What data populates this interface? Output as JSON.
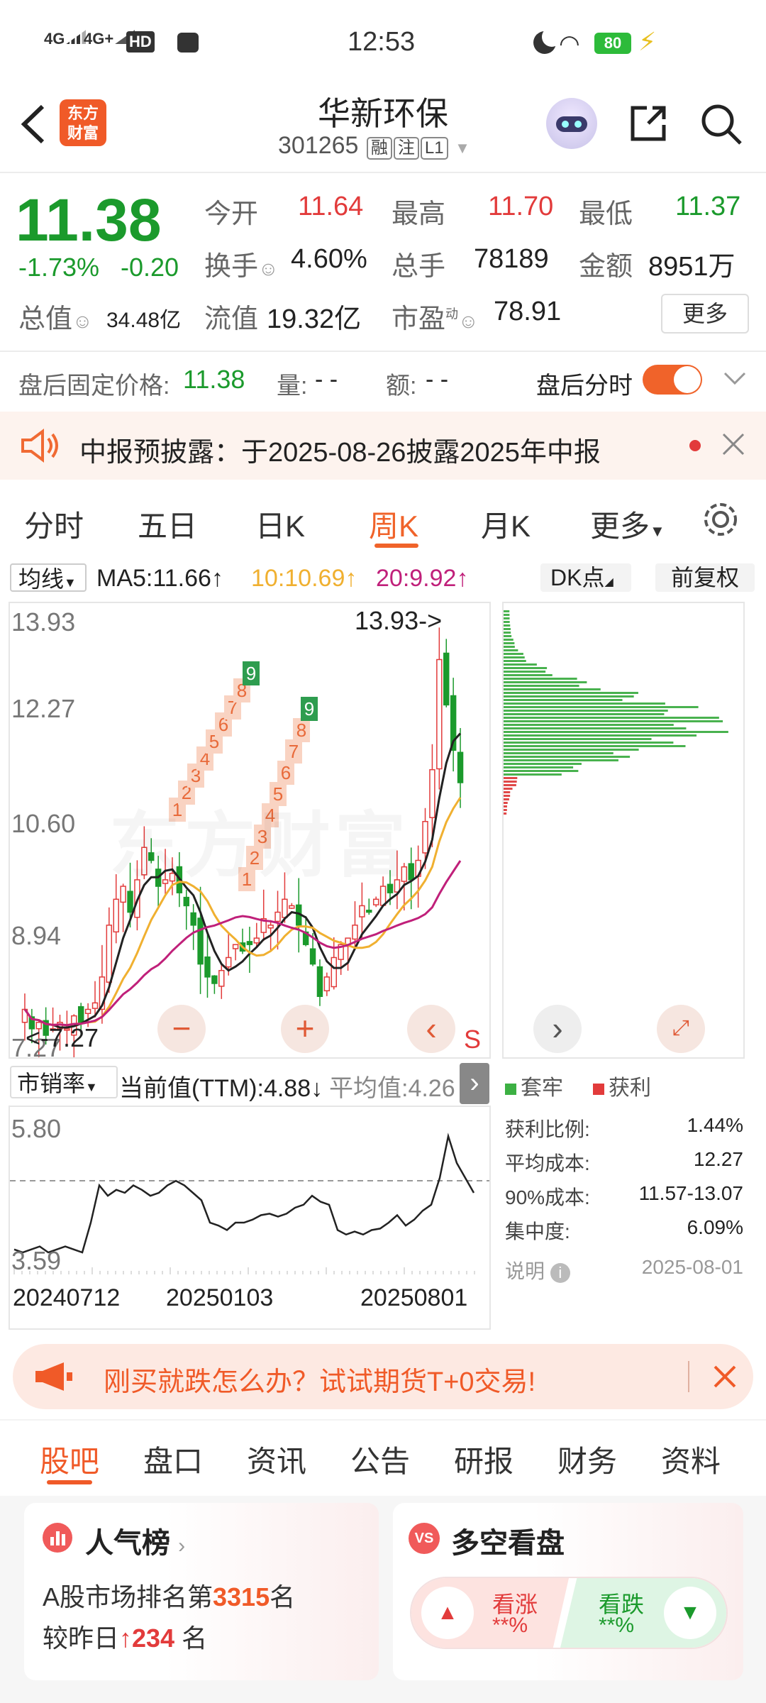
{
  "status_bar": {
    "time": "12:53",
    "network_1": "4G",
    "network_2": "4G+",
    "hd": "HD",
    "battery": "80"
  },
  "header": {
    "logo_line1": "东方",
    "logo_line2": "财富",
    "title": "华新环保",
    "code": "301265",
    "badges": [
      "融",
      "注",
      "L1"
    ]
  },
  "quote": {
    "price": "11.38",
    "change_pct": "-1.73%",
    "change": "-0.20",
    "open_label": "今开",
    "open": "11.64",
    "high_label": "最高",
    "high": "11.70",
    "low_label": "最低",
    "low": "11.37",
    "turnover_label": "换手",
    "turnover": "4.60%",
    "volume_label": "总手",
    "volume": "78189",
    "amount_label": "金额",
    "amount": "8951万",
    "mktcap_label": "总值",
    "mktcap": "34.48亿",
    "float_label": "流值",
    "float_cap": "19.32亿",
    "pe_label": "市盈",
    "pe_sup": "动",
    "pe": "78.91",
    "more": "更多"
  },
  "after_hours": {
    "fixed_label": "盘后固定价格:",
    "fixed_price": "11.38",
    "volume_label": "量:",
    "volume": "- -",
    "amount_label": "额:",
    "amount": "- -",
    "timeshare_label": "盘后分时"
  },
  "notice": {
    "text": "中报预披露：于2025-08-26披露2025年中报"
  },
  "chart_tabs": [
    "分时",
    "五日",
    "日K",
    "周K",
    "月K",
    "更多"
  ],
  "active_tab": "周K",
  "ma_bar": {
    "selector": "均线",
    "ma5": "MA5:11.66↑",
    "ma10": "10:10.69↑",
    "ma20": "20:9.92↑",
    "dk": "DK点",
    "adjust": "前复权"
  },
  "kline": {
    "y_labels": [
      "13.93",
      "12.27",
      "10.60",
      "8.94",
      "7.27"
    ],
    "high_marker": "13.93->",
    "low_marker": "<-7.27",
    "signal": "S",
    "watermark": "东方财富",
    "nine_a": [
      "1",
      "2",
      "3",
      "4",
      "5",
      "6",
      "7",
      "8",
      "9"
    ],
    "nine_b": [
      "1",
      "2",
      "3",
      "4",
      "5",
      "6",
      "7",
      "8",
      "9"
    ],
    "colors": {
      "up": "#e23b3b",
      "down": "#1b9a2c",
      "ma5": "#222222",
      "ma10": "#f0b030",
      "ma20": "#c0207a"
    }
  },
  "chart_data": {
    "type": "candlestick",
    "period": "weekly",
    "ylim": [
      7.27,
      13.93
    ],
    "max_label": 13.93,
    "min_label": 7.27,
    "ma": {
      "MA5": 11.66,
      "MA10": 10.69,
      "MA20": 9.92
    },
    "ps_indicator": {
      "name": "市销率",
      "current_label": "当前值(TTM):4.88↓",
      "average_label": "平均值:4.26",
      "ylim": [
        3.59,
        5.8
      ],
      "x_labels": [
        "20240712",
        "20250103",
        "20250801"
      ]
    }
  },
  "indicator": {
    "selector": "市销率",
    "current": "当前值(TTM):4.88↓",
    "average": "平均值:4.26",
    "y_top": "5.80",
    "y_bottom": "3.59",
    "dates": [
      "20240712",
      "20250103",
      "20250801"
    ]
  },
  "chip_panel": {
    "legend_trapped": "套牢",
    "legend_profit": "获利",
    "rows": [
      {
        "label": "获利比例:",
        "value": "1.44%"
      },
      {
        "label": "平均成本:",
        "value": "12.27"
      },
      {
        "label": "90%成本:",
        "value": "11.57-13.07"
      },
      {
        "label": "集中度:",
        "value": "6.09%"
      }
    ],
    "note": "说明",
    "date": "2025-08-01"
  },
  "ad": {
    "text": "刚买就跌怎么办？试试期货T+0交易!"
  },
  "bottom_tabs": [
    "股吧",
    "盘口",
    "资讯",
    "公告",
    "研报",
    "财务",
    "资料"
  ],
  "active_bottom_tab": "股吧",
  "popularity": {
    "title": "人气榜",
    "line1_prefix": "A股市场排名第",
    "rank": "3315",
    "line1_suffix": "名",
    "line2_prefix": "较昨日",
    "change": "234",
    "line2_suffix": "名"
  },
  "vote": {
    "title": "多空看盘",
    "bull": "看涨",
    "bull_pct": "**%",
    "bear": "看跌",
    "bear_pct": "**%"
  }
}
